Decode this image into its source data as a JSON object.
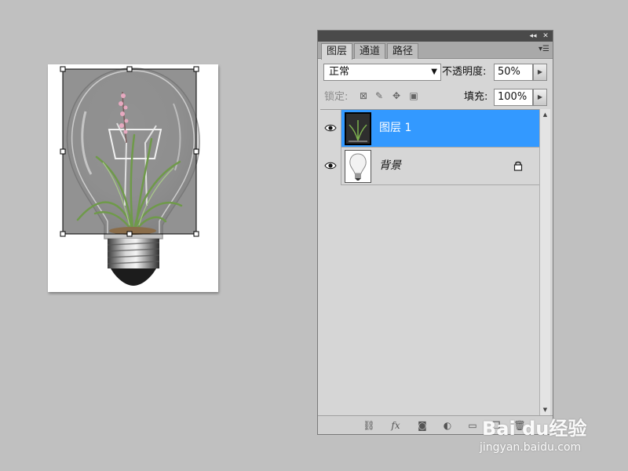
{
  "panel": {
    "tabs": [
      {
        "label": "图层",
        "active": true
      },
      {
        "label": "通道",
        "active": false
      },
      {
        "label": "路径",
        "active": false
      }
    ],
    "blend_mode": "正常",
    "opacity_label": "不透明度:",
    "opacity_value": "50%",
    "lock_label": "锁定:",
    "fill_label": "填充:",
    "fill_value": "100%",
    "layers": [
      {
        "name": "图层 1",
        "selected": true,
        "visible": true
      },
      {
        "name": "背景",
        "selected": false,
        "visible": true,
        "locked": true
      }
    ],
    "footer_buttons": [
      "link-layers",
      "fx",
      "add-mask",
      "adjustment",
      "new-group",
      "new-layer",
      "delete-layer"
    ]
  },
  "colors": {
    "selection": "#3399ff",
    "panel_bg": "#d6d6d6",
    "titlebar": "#4a4a4a",
    "workspace": "#c0c0c0"
  },
  "watermark": {
    "logo": "Bai du经验",
    "url": "jingyan.baidu.com"
  }
}
